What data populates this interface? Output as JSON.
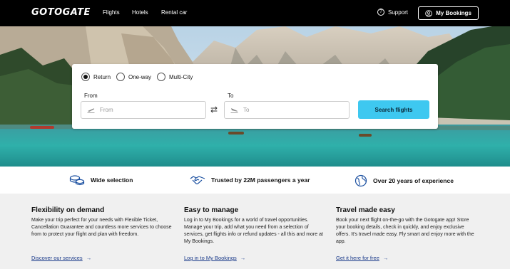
{
  "header": {
    "logo": "GOTOGATE",
    "nav": [
      "Flights",
      "Hotels",
      "Rental car"
    ],
    "support_label": "Support",
    "support_icon": "question-circle-icon",
    "my_bookings_label": "My Bookings",
    "my_bookings_icon": "user-icon"
  },
  "search": {
    "trip_types": [
      {
        "label": "Return",
        "selected": true
      },
      {
        "label": "One-way",
        "selected": false
      },
      {
        "label": "Multi-City",
        "selected": false
      }
    ],
    "from_label": "From",
    "from_placeholder": "From",
    "to_label": "To",
    "to_placeholder": "To",
    "swap_icon": "swap-icon",
    "search_button": "Search flights"
  },
  "features": [
    {
      "icon": "coins-icon",
      "text": "Wide selection"
    },
    {
      "icon": "handshake-icon",
      "text": "Trusted by 22M passengers a year"
    },
    {
      "icon": "globe-icon",
      "text": "Over 20 years of experience"
    }
  ],
  "info": [
    {
      "title": "Flexibility on demand",
      "body": "Make your trip perfect for your needs with Flexible Ticket, Cancellation Guarantee and countless more services to choose from to protect your flight and plan with freedom.",
      "link": "Discover our services"
    },
    {
      "title": "Easy to manage",
      "body": "Log in to My Bookings for a world of travel opportunities. Manage your trip, add what you need from a selection of services, get flights info or refund updates - all this and more at My Bookings.",
      "link": "Log in to My Bookings"
    },
    {
      "title": "Travel made easy",
      "body": "Book your next flight on-the-go with the Gotogate app! Store your booking details, check in quickly, and enjoy exclusive offers. It's travel made easy. Fly smart and enjoy more with the app.",
      "link": "Get it here for free"
    }
  ],
  "colors": {
    "header_bg": "#000000",
    "accent_button": "#3ec8f0",
    "link": "#1a3a8a"
  }
}
